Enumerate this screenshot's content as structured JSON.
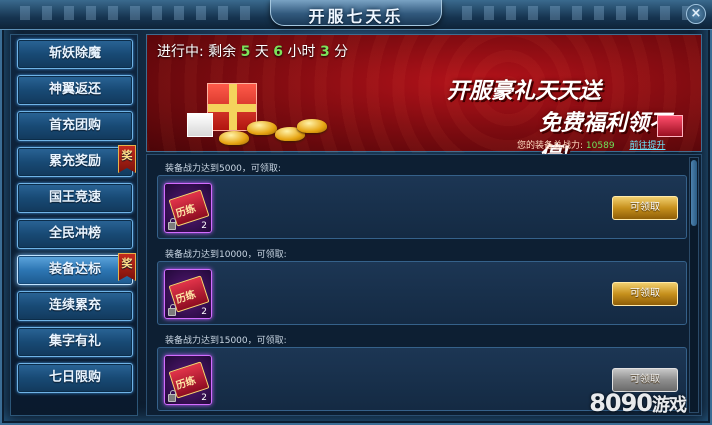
{
  "window": {
    "title": "开服七天乐",
    "close_label": "×"
  },
  "sidebar": {
    "items": [
      {
        "label": "斩妖除魔",
        "active": false,
        "badge": ""
      },
      {
        "label": "神翼返还",
        "active": false,
        "badge": ""
      },
      {
        "label": "首充团购",
        "active": false,
        "badge": ""
      },
      {
        "label": "累充奖励",
        "active": false,
        "badge": "奖"
      },
      {
        "label": "国王竞速",
        "active": false,
        "badge": ""
      },
      {
        "label": "全民冲榜",
        "active": false,
        "badge": ""
      },
      {
        "label": "装备达标",
        "active": true,
        "badge": "奖"
      },
      {
        "label": "连续累充",
        "active": false,
        "badge": ""
      },
      {
        "label": "集字有礼",
        "active": false,
        "badge": ""
      },
      {
        "label": "七日限购",
        "active": false,
        "badge": ""
      }
    ]
  },
  "banner": {
    "countdown_prefix": "进行中: 剩余",
    "days": "5",
    "days_unit": "天",
    "hours": "6",
    "hours_unit": "小时",
    "minutes": "3",
    "minutes_unit": "分",
    "slogan_line1": "开服豪礼天天送",
    "slogan_line2": "免费福利领不停!",
    "power_label": "您的装备总战力:",
    "power_value": "10589",
    "power_link": "前往提升"
  },
  "rewards": [
    {
      "requirement": "装备战力达到5000，可领取:",
      "item_text": "历练",
      "qty": "2",
      "button": "可领取",
      "enabled": true
    },
    {
      "requirement": "装备战力达到10000，可领取:",
      "item_text": "历练",
      "qty": "2",
      "button": "可领取",
      "enabled": true
    },
    {
      "requirement": "装备战力达到15000，可领取:",
      "item_text": "历练",
      "qty": "2",
      "button": "可领取",
      "enabled": false
    }
  ],
  "watermark": {
    "number": "8090",
    "text": "游戏"
  }
}
